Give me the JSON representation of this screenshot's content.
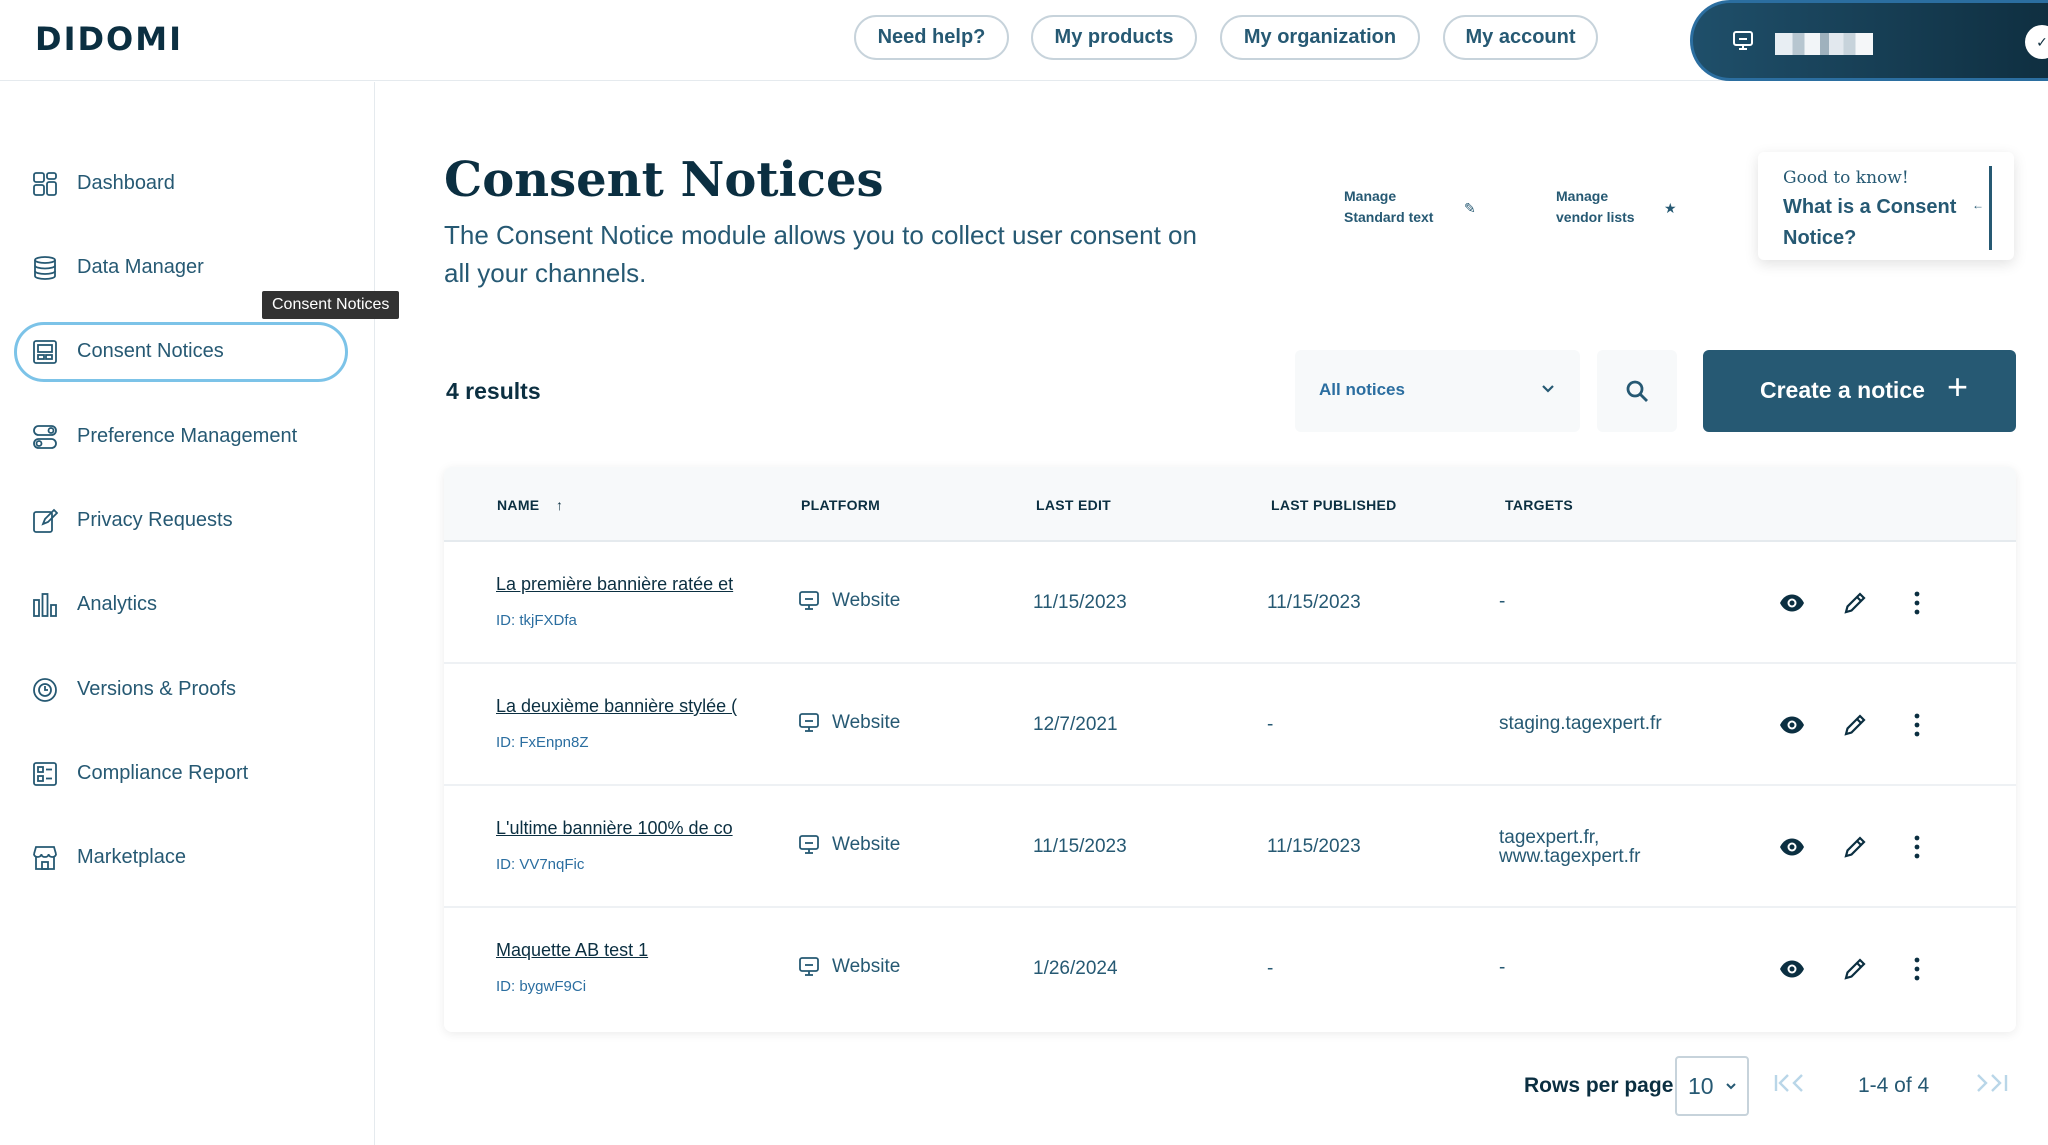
{
  "app": {
    "logo": "DIDOMI"
  },
  "topnav": {
    "help": "Need help?",
    "products": "My products",
    "organization": "My organization",
    "account": "My account"
  },
  "sidebar": {
    "items": [
      {
        "label": "Dashboard",
        "icon": "dashboard-icon"
      },
      {
        "label": "Data Manager",
        "icon": "database-icon"
      },
      {
        "label": "Consent Notices",
        "icon": "notice-icon",
        "active": true
      },
      {
        "label": "Preference Management",
        "icon": "toggles-icon"
      },
      {
        "label": "Privacy Requests",
        "icon": "edit-document-icon"
      },
      {
        "label": "Analytics",
        "icon": "bar-chart-icon"
      },
      {
        "label": "Versions & Proofs",
        "icon": "history-icon"
      },
      {
        "label": "Compliance Report",
        "icon": "report-icon"
      },
      {
        "label": "Marketplace",
        "icon": "store-icon"
      }
    ],
    "tooltip": "Consent Notices"
  },
  "header": {
    "title": "Consent Notices",
    "subtitle": "The Consent Notice module allows you to collect user consent on all your channels.",
    "manage_text_1": "Manage",
    "manage_text_2": "Standard text",
    "manage_vendor_1": "Manage",
    "manage_vendor_2": "vendor lists",
    "tip_small": "Good to know!",
    "tip_title": "What is a Consent Notice?"
  },
  "filters": {
    "results": "4 results",
    "select_value": "All notices",
    "create_label": "Create a notice"
  },
  "table": {
    "columns": [
      "NAME",
      "PLATFORM",
      "LAST EDIT",
      "LAST PUBLISHED",
      "TARGETS"
    ],
    "rows": [
      {
        "name": "La première bannière ratée et",
        "id": "ID: tkjFXDfa",
        "platform": "Website",
        "last_edit": "11/15/2023",
        "last_published": "11/15/2023",
        "targets": "-"
      },
      {
        "name": "La deuxième bannière stylée (",
        "id": "ID: FxEnpn8Z",
        "platform": "Website",
        "last_edit": "12/7/2021",
        "last_published": "-",
        "targets": "staging.tagexpert.fr"
      },
      {
        "name": "L'ultime bannière 100% de co",
        "id": "ID: VV7nqFic",
        "platform": "Website",
        "last_edit": "11/15/2023",
        "last_published": "11/15/2023",
        "targets": "tagexpert.fr,\nwww.tagexpert.fr"
      },
      {
        "name": "Maquette AB test 1",
        "id": "ID: bygwF9Ci",
        "platform": "Website",
        "last_edit": "1/26/2024",
        "last_published": "-",
        "targets": "-"
      }
    ]
  },
  "pagination": {
    "rows_label": "Rows per page",
    "rows_value": "10",
    "range": "1-4 of 4"
  },
  "colors": {
    "primary": "#265973",
    "dark": "#0b2f41",
    "accent": "#7cc3e8",
    "link": "#2b6ea0"
  }
}
